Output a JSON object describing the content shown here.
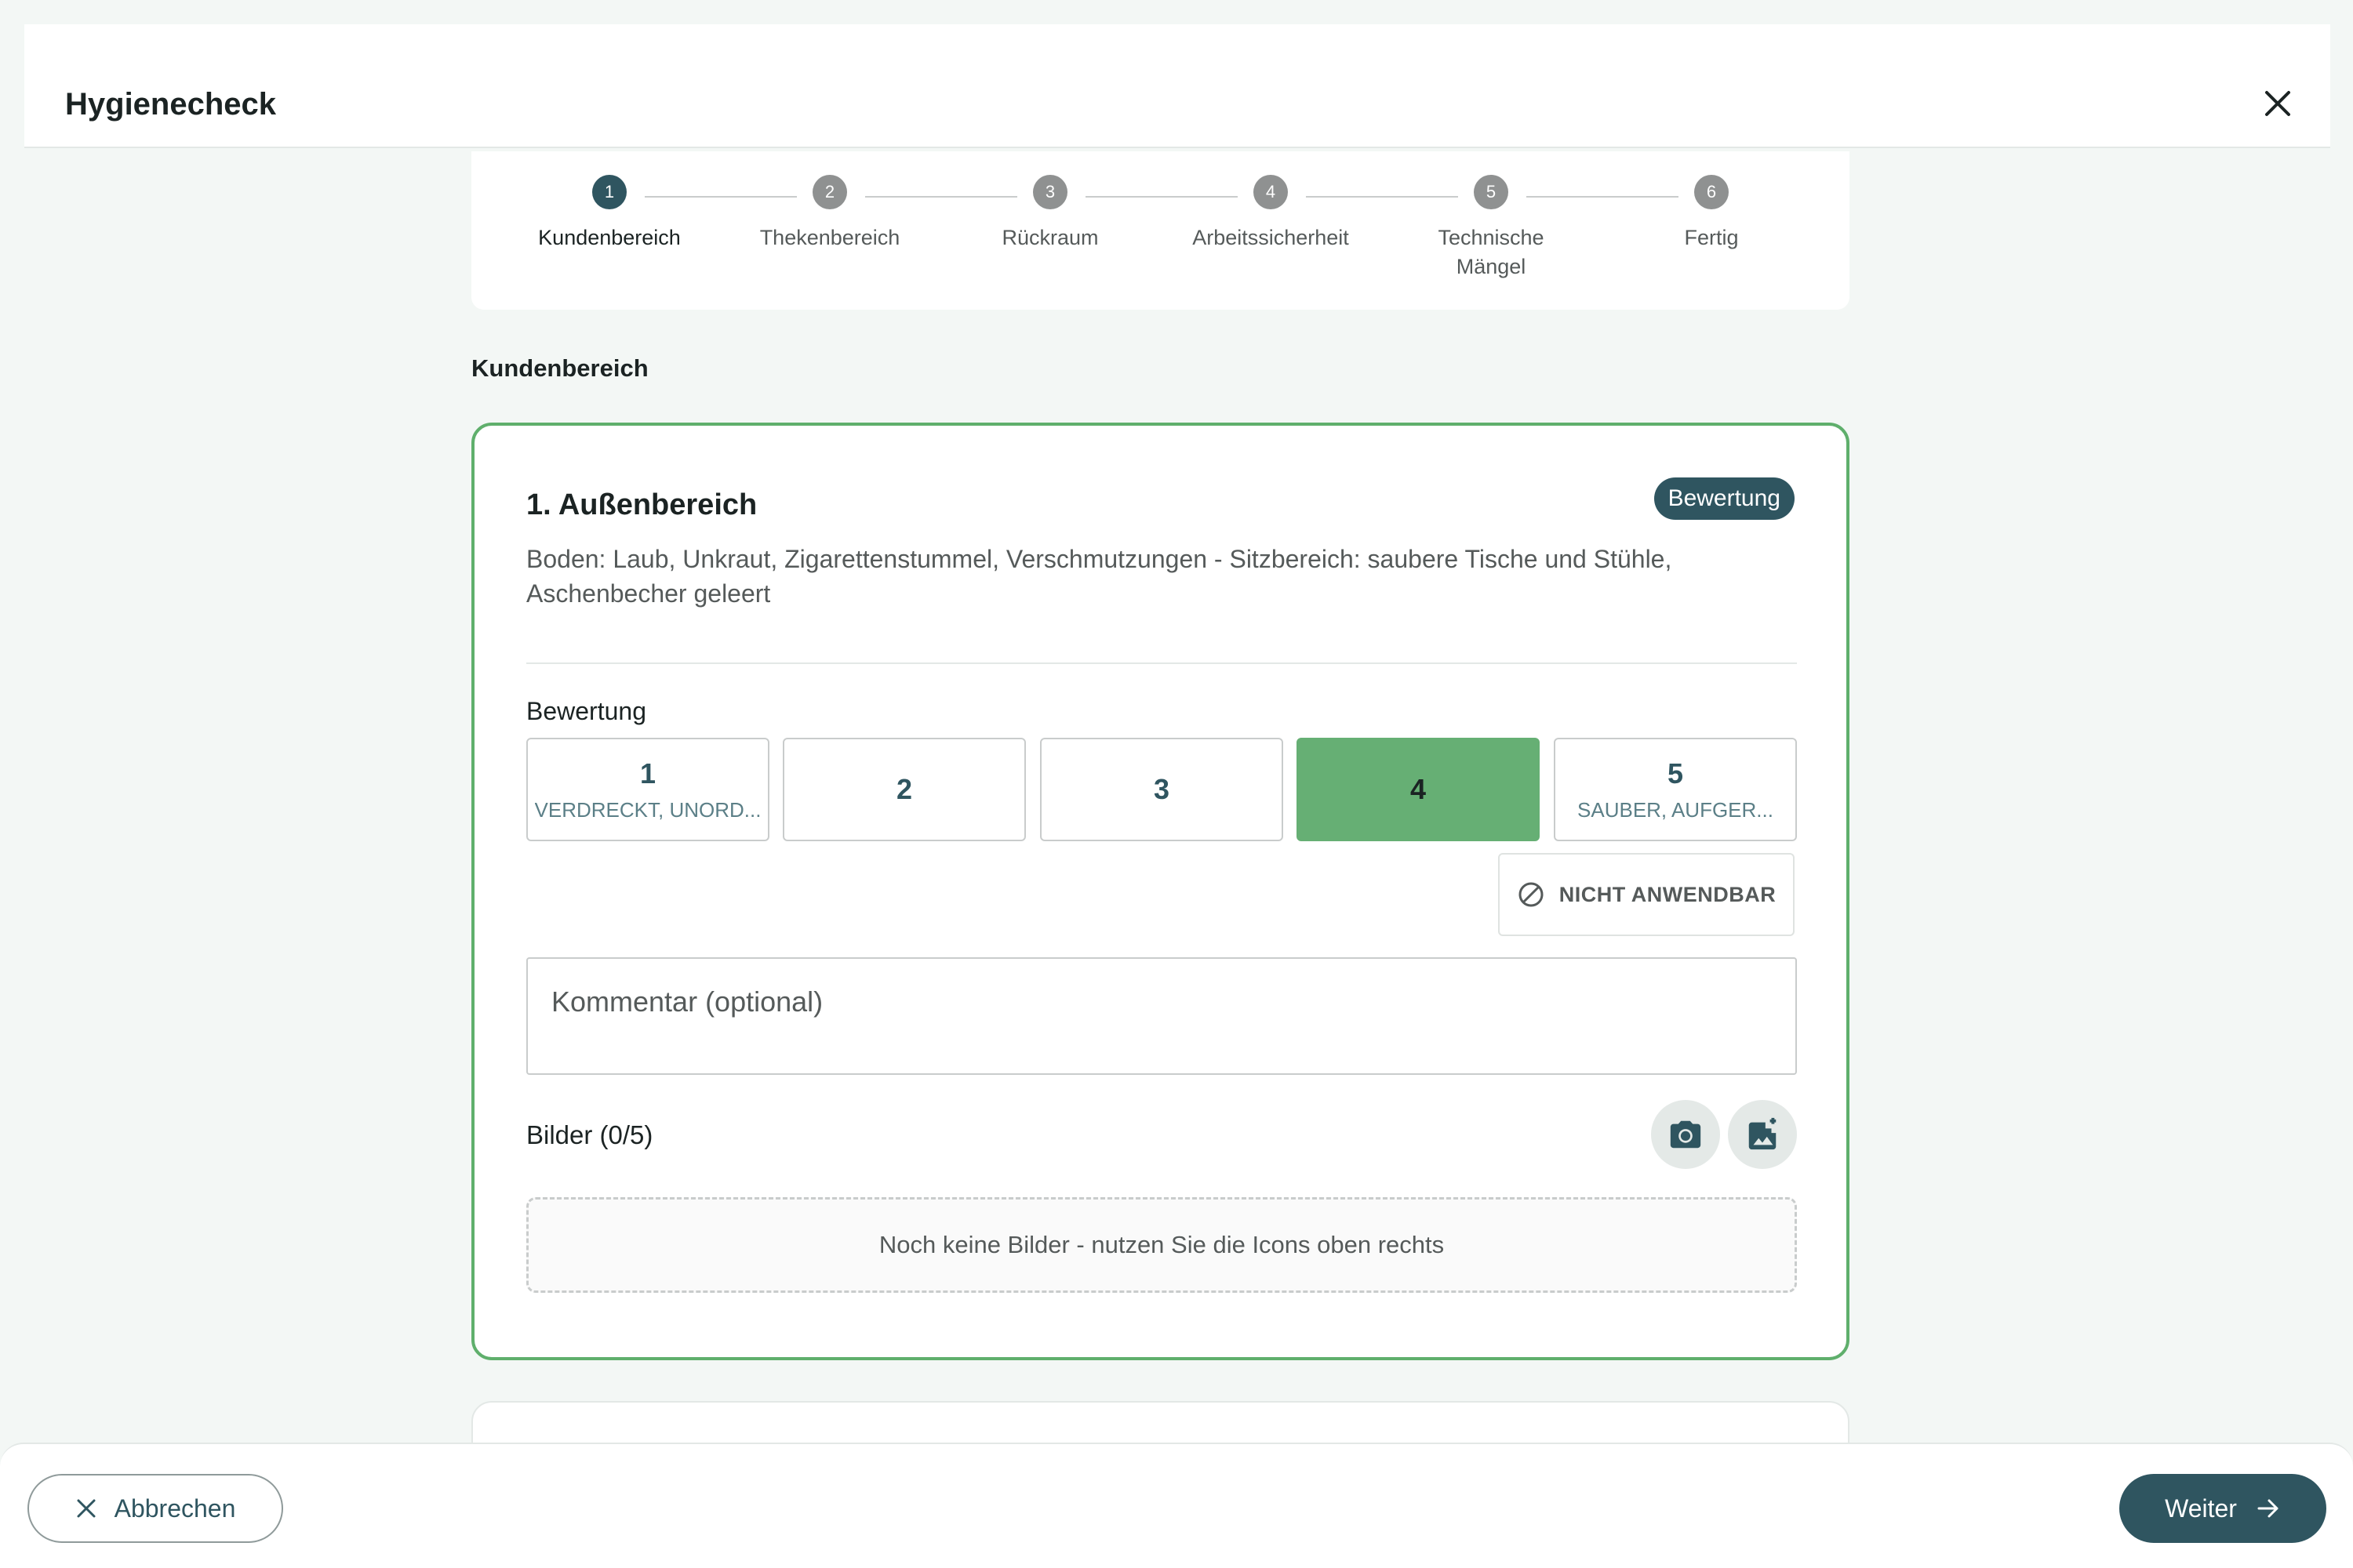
{
  "header": {
    "title": "Hygienecheck",
    "close_icon": "close-icon"
  },
  "stepper": {
    "steps": [
      {
        "number": "1",
        "label": "Kundenbereich",
        "active": true
      },
      {
        "number": "2",
        "label": "Thekenbereich",
        "active": false
      },
      {
        "number": "3",
        "label": "Rückraum",
        "active": false
      },
      {
        "number": "4",
        "label": "Arbeitssicherheit",
        "active": false
      },
      {
        "number": "5",
        "label": "Technische Mängel",
        "active": false
      },
      {
        "number": "6",
        "label": "Fertig",
        "active": false
      }
    ]
  },
  "section": {
    "title": "Kundenbereich"
  },
  "item": {
    "title": "1. Außenbereich",
    "badge": "Bewertung",
    "description": "Boden: Laub, Unkraut, Zigarettenstummel, Verschmutzungen - Sitzbereich: saubere Tische und Stühle, Aschenbecher geleert",
    "rating_label": "Bewertung",
    "ratings": [
      {
        "value": "1",
        "sub": "VERDRECKT, UNORD..."
      },
      {
        "value": "2",
        "sub": ""
      },
      {
        "value": "3",
        "sub": ""
      },
      {
        "value": "4",
        "sub": ""
      },
      {
        "value": "5",
        "sub": "SAUBER, AUFGER..."
      }
    ],
    "selected_rating": "4",
    "not_applicable_label": "NICHT ANWENDBAR",
    "comment": {
      "value": "",
      "placeholder": "Kommentar (optional)"
    },
    "images_label": "Bilder (0/5)",
    "images_empty_text": "Noch keine Bilder - nutzen Sie die Icons oben rechts",
    "camera_icon": "camera-icon",
    "add_image_icon": "add-photo-icon"
  },
  "footer": {
    "cancel_label": "Abbrechen",
    "next_label": "Weiter"
  },
  "colors": {
    "primary": "#2f5560",
    "accent_green": "#66af74",
    "card_border": "#5faf6c",
    "background": "#f3f7f5"
  }
}
